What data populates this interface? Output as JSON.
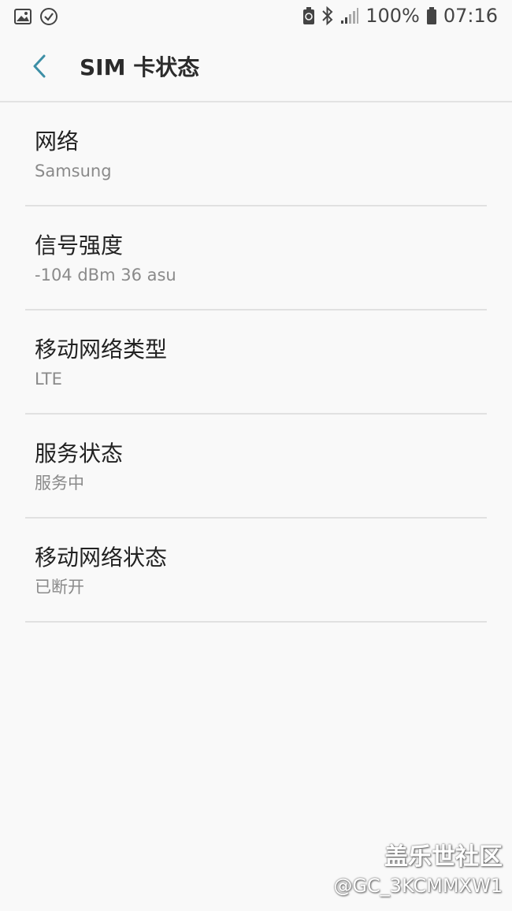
{
  "status_bar": {
    "battery_percent": "100%",
    "time": "07:16",
    "icons": [
      "image-icon",
      "check-circle-icon",
      "battery-saver-icon",
      "bluetooth-icon",
      "signal-icon",
      "battery-icon"
    ]
  },
  "header": {
    "title": "SIM 卡状态",
    "back_icon": "back-arrow-icon"
  },
  "items": [
    {
      "title": "网络",
      "value": "Samsung"
    },
    {
      "title": "信号强度",
      "value": "-104 dBm 36 asu"
    },
    {
      "title": "移动网络类型",
      "value": "LTE"
    },
    {
      "title": "服务状态",
      "value": "服务中"
    },
    {
      "title": "移动网络状态",
      "value": "已断开"
    }
  ],
  "watermark": {
    "title": "盖乐世社区",
    "user": "@GC_3KCMMXW1"
  },
  "colors": {
    "accent": "#3d8fa6",
    "background": "#f9f9f9",
    "secondary_text": "#8a8a8a",
    "divider": "#e1e1e1"
  }
}
